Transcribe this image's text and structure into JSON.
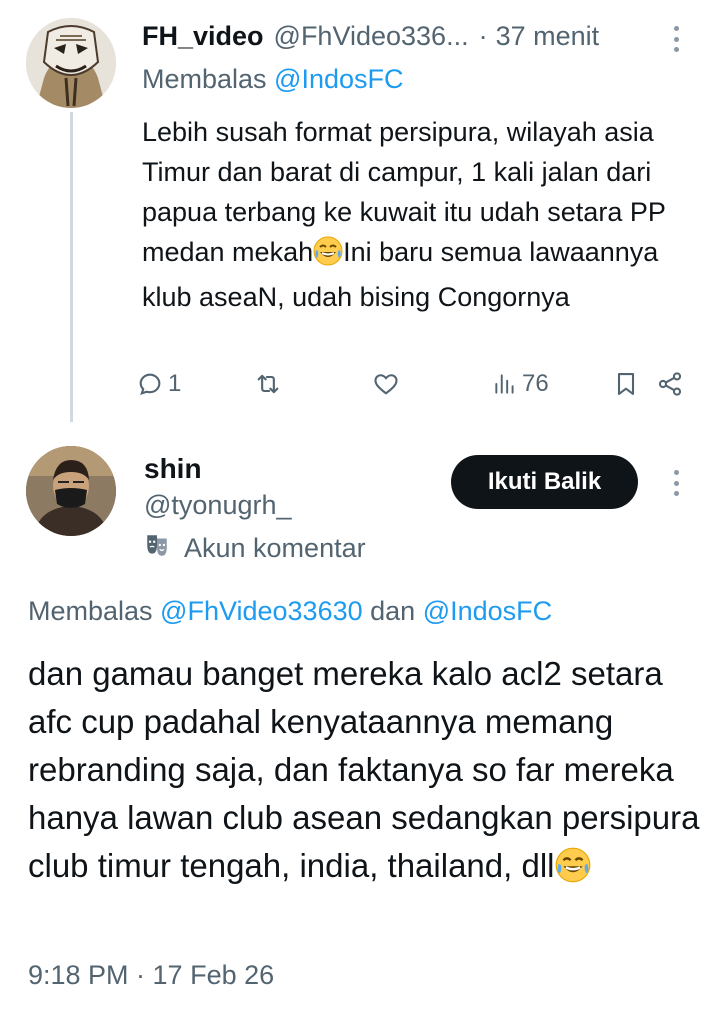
{
  "parent": {
    "name": "FH_video",
    "handle": "@FhVideo336...",
    "separator": "·",
    "time": "37 menit",
    "reply_prefix": "Membalas ",
    "reply_mention": "@IndosFC",
    "text_part1": "Lebih susah format persipura, wilayah asia Timur dan barat di campur, 1 kali jalan dari papua terbang ke kuwait itu udah setara PP medan mekah",
    "text_part2": "Ini baru semua lawaannya klub aseaN, udah bising Congornya",
    "actions": {
      "reply_count": "1",
      "views_count": "76"
    },
    "icons": [
      "avatar",
      "more-vertical-icon",
      "reply-icon",
      "retweet-icon",
      "like-icon",
      "views-icon",
      "bookmark-icon",
      "share-icon",
      "laughing-emoji-icon"
    ]
  },
  "reply": {
    "name": "shin",
    "handle": "@tyonugrh_",
    "account_label": "Akun komentar",
    "follow_button": "Ikuti Balik",
    "reply_prefix": "Membalas ",
    "reply_mention_1": "@FhVideo33630",
    "reply_and": " dan ",
    "reply_mention_2": "@IndosFC",
    "text": "dan gamau banget mereka kalo acl2 setara afc cup padahal kenyataannya memang rebranding saja, dan faktanya so far mereka hanya lawan club asean sedangkan persipura club timur tengah, india, thailand, dll",
    "timestamp": "9:18 PM · 17 Feb 26",
    "icons": [
      "avatar",
      "parody-mask-icon",
      "more-vertical-icon",
      "laughing-emoji-icon"
    ]
  },
  "colors": {
    "text": "#0f1419",
    "secondary": "#536471",
    "link": "#1d9bf0",
    "button_bg": "#0f1419",
    "thread_line": "#cfd9de"
  }
}
